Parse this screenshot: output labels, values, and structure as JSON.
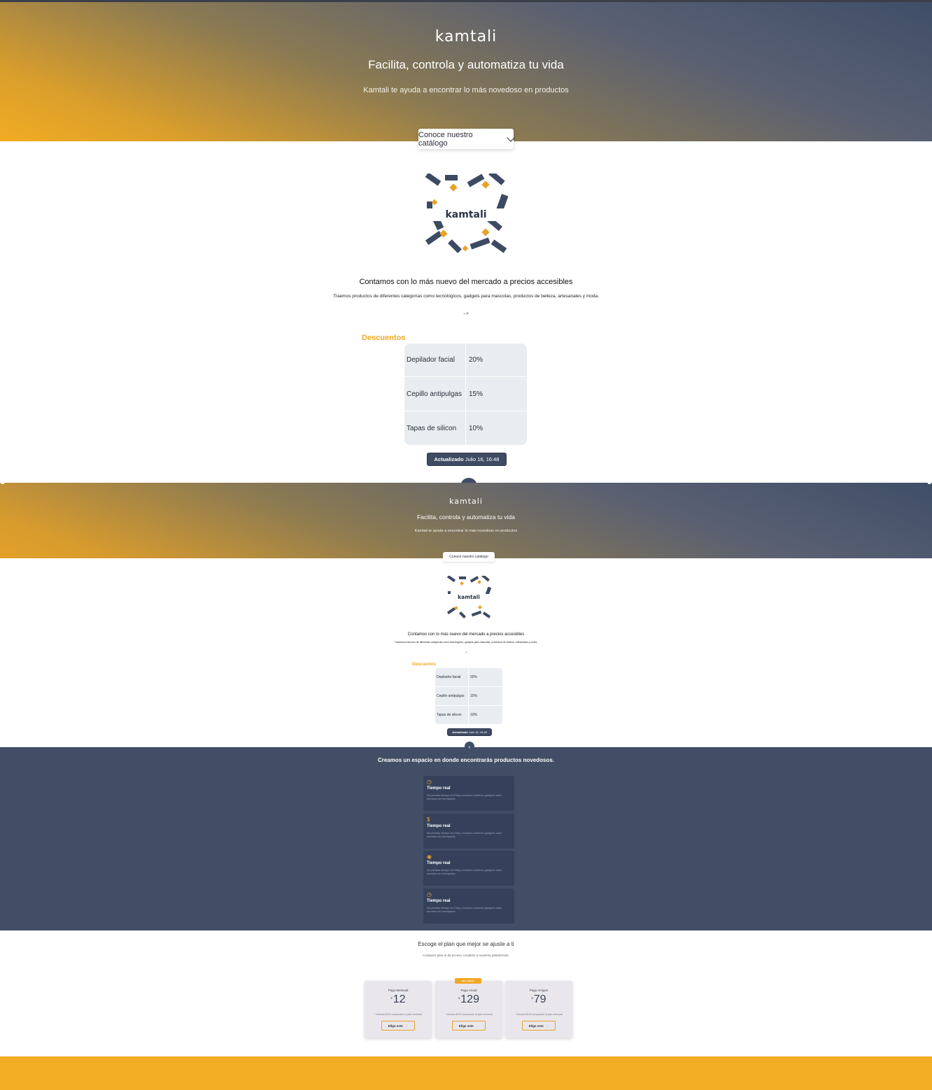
{
  "hero": {
    "logo": "kamtali",
    "title": "Facilita, controla y automatiza tu vida",
    "subtitle": "Kamtali te ayuda a encontrar lo más novedoso en productos",
    "catalog_button": "Conoce nuestro catálogo"
  },
  "intro": {
    "image_logo": "kamtali",
    "heading": "Contamos con lo más nuevo del mercado a precios accesibles",
    "text": "Traemos productos de diferentes categorías como tecnológicos, gadgets para mascotas, productos de belleza, artesanales y moda.",
    "arrow": "-->"
  },
  "discounts": {
    "title": "Descuentos",
    "rows": [
      {
        "product": "Depilador facial",
        "discount": "20%"
      },
      {
        "product": "Cepillo antipulgas",
        "discount": "15%"
      },
      {
        "product": "Tapas de silicon",
        "discount": "10%"
      }
    ],
    "updated_label": "Actualizado",
    "updated_value": "Julio 16, 16:48"
  },
  "hero_small": {
    "logo": "kamtali",
    "title": "Facilita, controla y automatiza tu vida",
    "subtitle": "Kamtali te ayuda a encontrar lo más novedoso en productos",
    "catalog_button": "Conoce nuestro catálogo"
  },
  "intro_small": {
    "heading": "Contamos con lo más nuevo del mercado a precios accesibles",
    "text": "Traemos productos de diferentes categorías como tecnológicos, gadgets para mascotas, productos de belleza, artesanales y moda.",
    "arrow": "-->"
  },
  "discounts_small": {
    "title": "Descuentos",
    "rows": [
      {
        "product": "Depilador facial",
        "discount": "20%"
      },
      {
        "product": "Cepillo antipulgas",
        "discount": "15%"
      },
      {
        "product": "Tapas de silicon",
        "discount": "10%"
      }
    ],
    "updated_label": "Actualizado",
    "updated_value": "Julio 16, 16:48"
  },
  "features": {
    "heading": "Creamos un espacio en donde encontrarás productos novedosos.",
    "items": [
      {
        "icon": "clock-icon",
        "glyph": "◷",
        "title": "Tiempo real",
        "desc": "No pierdas tiempo en Ebay, nosotros subimos gadgets cada semana así reemplaza."
      },
      {
        "icon": "dollar-icon",
        "glyph": "$",
        "title": "Tiempo real",
        "desc": "No pierdas tiempo en Ebay, nosotros subimos gadgets cada semana así reemplaza."
      },
      {
        "icon": "eye-icon",
        "glyph": "◉",
        "title": "Tiempo real",
        "desc": "No pierdas tiempo en Ebay, nosotros subimos gadgets cada semana así reemplaza."
      },
      {
        "icon": "clock-icon",
        "glyph": "◷",
        "title": "Tiempo real",
        "desc": "No pierdas tiempo en Ebay, nosotros subimos gadgets cada semana así reemplaza."
      }
    ]
  },
  "pricing": {
    "heading": "Escoge el plan que mejor se ajuste a ti",
    "subheading": "Cualquier plan te da acceso completo a nuestras plataformas.",
    "popular_badge": "Más popular",
    "plans": [
      {
        "name": "Pago Mensual",
        "currency": "$",
        "price": "12",
        "note": "* Ahorras $120 comparado al plan mensual",
        "cta": "Elige este"
      },
      {
        "name": "Pago Anual",
        "currency": "$",
        "price": "129",
        "note": "* Ahorras $100 comparado al plan mensual",
        "cta": "Elige este"
      },
      {
        "name": "Pago Amigos",
        "currency": "$",
        "price": "79",
        "note": "* Ahorras $149 comparado al plan mensual",
        "cta": "Elige este"
      }
    ]
  },
  "colors": {
    "accent": "#f1a828",
    "navy": "#414e66",
    "table_bg": "#e9ecf0"
  }
}
